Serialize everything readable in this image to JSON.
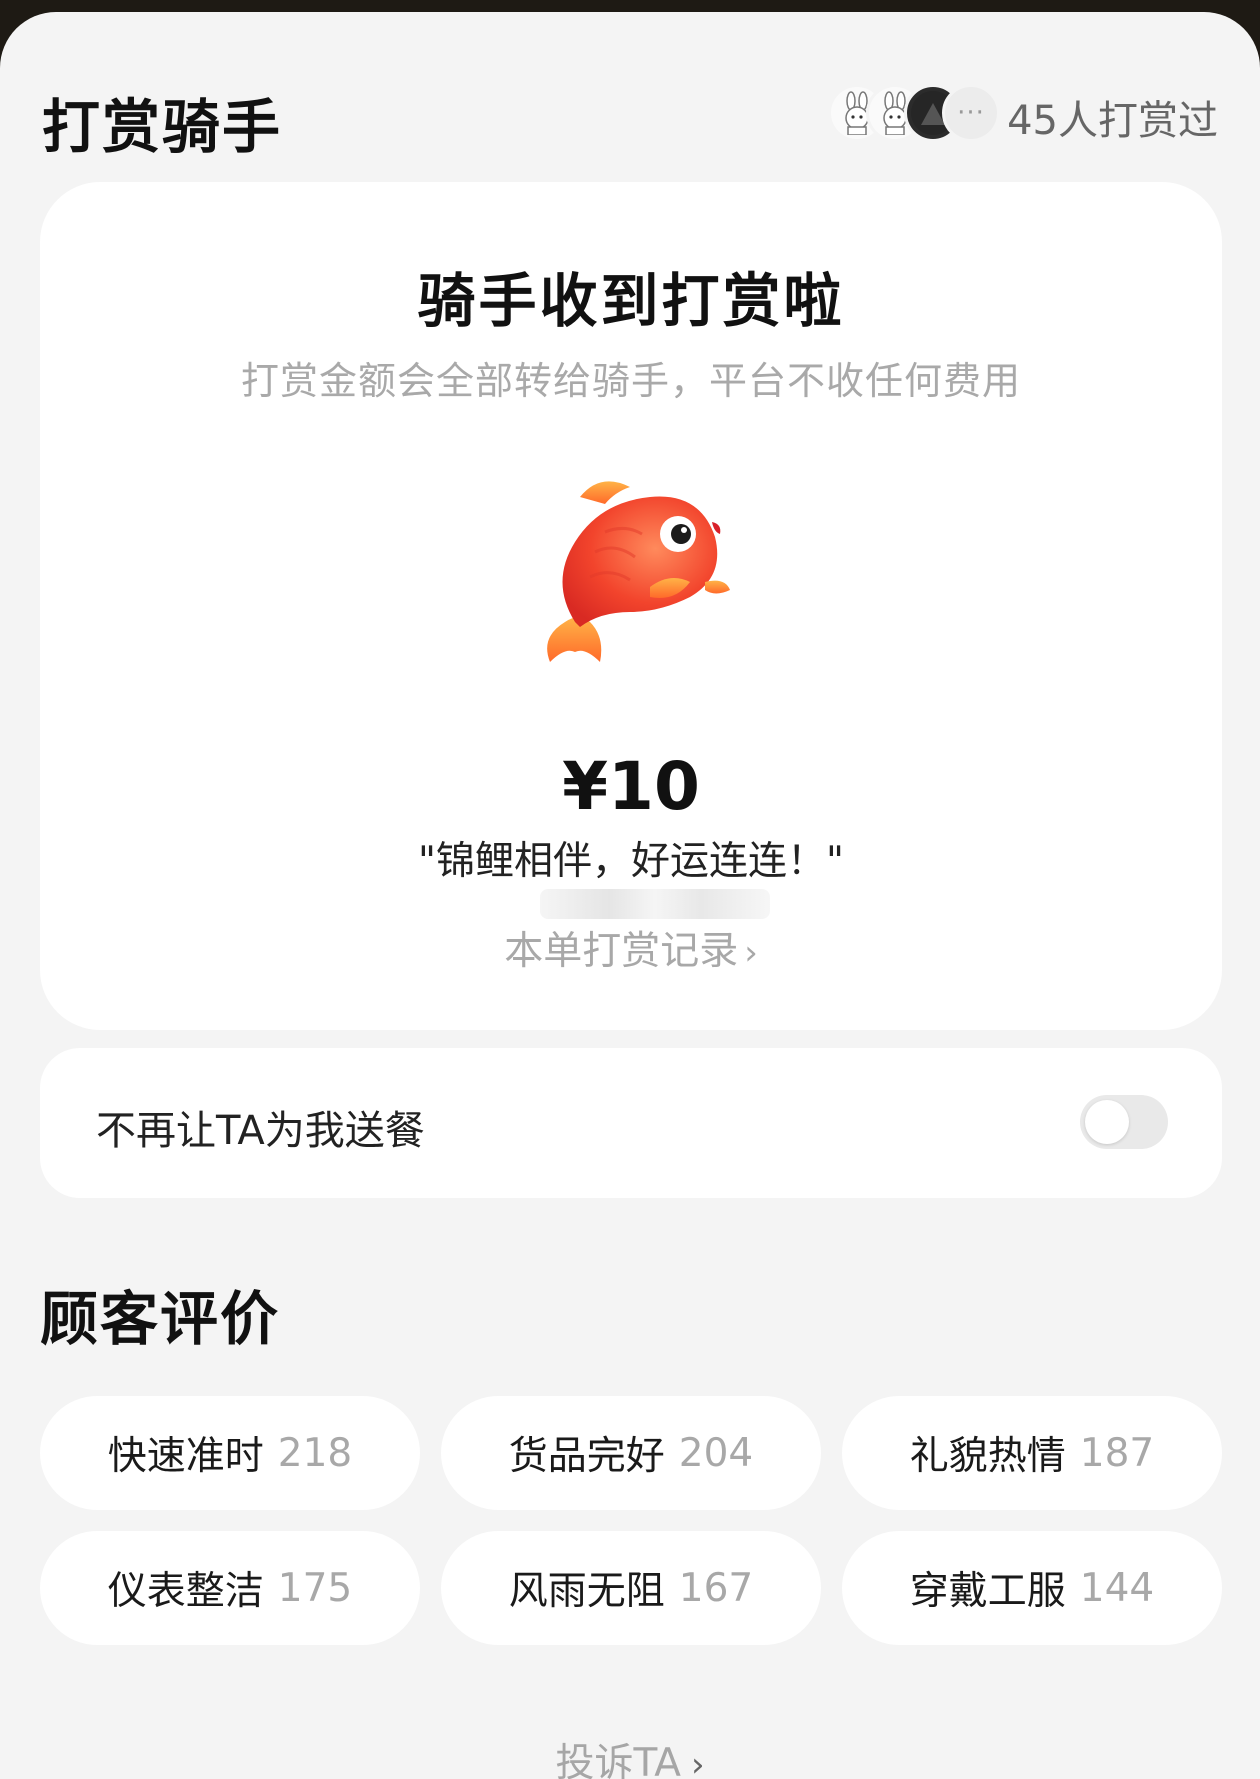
{
  "header": {
    "title": "打赏骑手",
    "avatars": [
      "avatar-rabbit-icon",
      "avatar-rabbit-icon",
      "avatar-dark-icon"
    ],
    "more": "···",
    "tip_count": "45人打赏过"
  },
  "tip_card": {
    "title": "骑手收到打赏啦",
    "subtitle": "打赏金额会全部转给骑手，平台不收任何费用",
    "gift_icon": "koi-fish-icon",
    "amount": "¥10",
    "message": "\"锦鲤相伴，好运连连！\"",
    "record_link": "本单打赏记录",
    "record_chevron": "›"
  },
  "settings": {
    "toggle_label": "不再让TA为我送餐",
    "toggle_on": false
  },
  "reviews": {
    "title": "顾客评价",
    "tags": [
      {
        "label": "快速准时",
        "count": "218"
      },
      {
        "label": "货品完好",
        "count": "204"
      },
      {
        "label": "礼貌热情",
        "count": "187"
      },
      {
        "label": "仪表整洁",
        "count": "175"
      },
      {
        "label": "风雨无阻",
        "count": "167"
      },
      {
        "label": "穿戴工服",
        "count": "144"
      }
    ]
  },
  "footer": {
    "complain_label": "投诉TA",
    "complain_chevron": "›"
  },
  "colors": {
    "background": "#f4f4f4",
    "card": "#ffffff",
    "muted_text": "#a8a8a8",
    "switch_off": "#e9e9e9"
  }
}
